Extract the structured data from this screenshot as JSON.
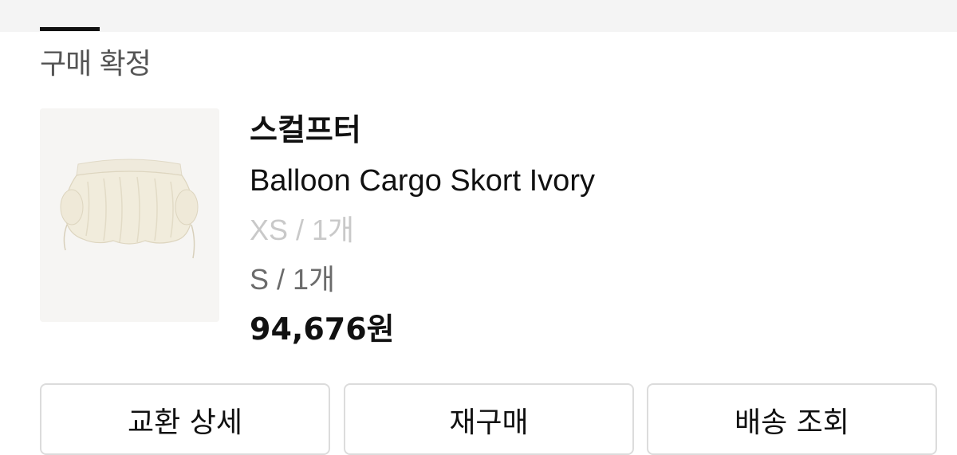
{
  "order": {
    "status": "구매 확정",
    "brand": "스컬프터",
    "product_name": "Balloon Cargo Skort Ivory",
    "options": [
      "XS / 1개",
      "S / 1개"
    ],
    "price": "94,676원",
    "thumbnail_icon": "skort-product-image"
  },
  "actions": {
    "exchange_detail": "교환 상세",
    "repurchase": "재구매",
    "track_delivery": "배송 조회"
  },
  "colors": {
    "muted_option": "#c9c9c9",
    "active_option": "#6b6b6b",
    "status_text": "#555555"
  }
}
